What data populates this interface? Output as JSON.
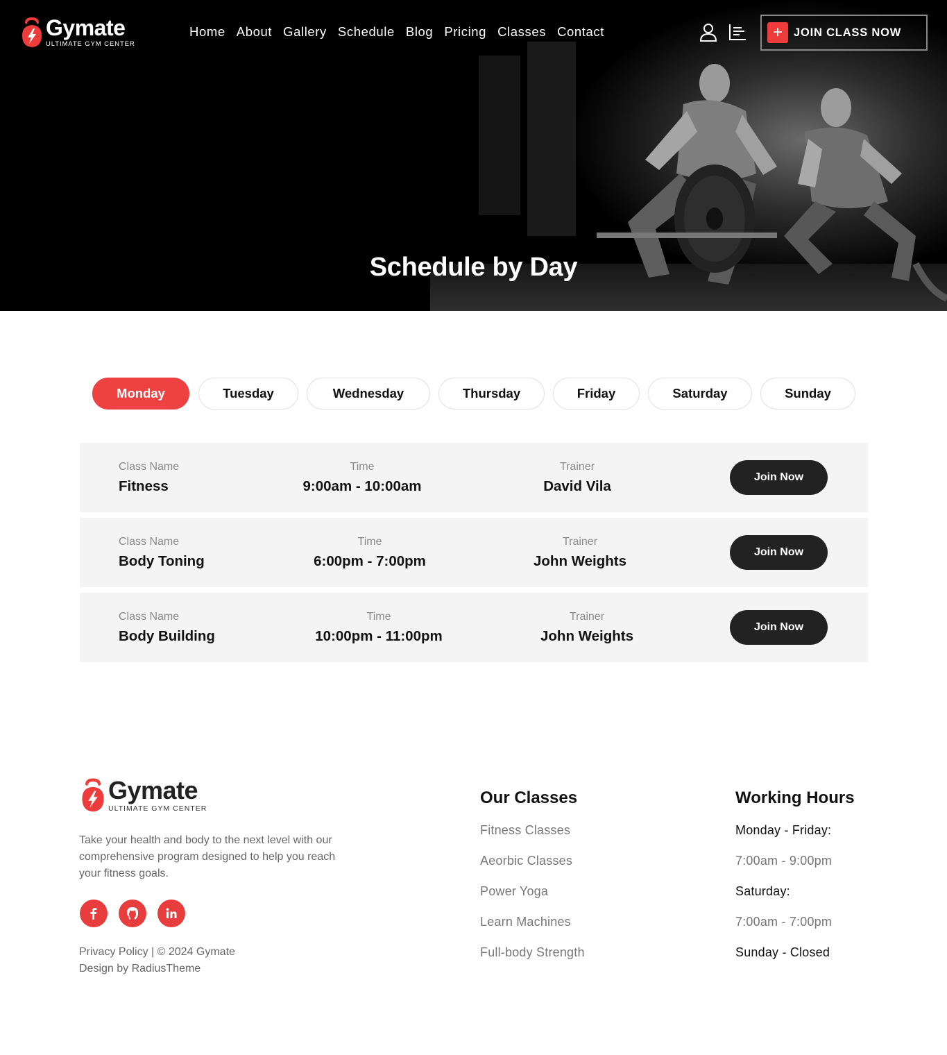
{
  "brand": {
    "name": "Gymate",
    "tagline": "ULTIMATE GYM CENTER"
  },
  "nav": {
    "items": [
      "Home",
      "About",
      "Gallery",
      "Schedule",
      "Blog",
      "Pricing",
      "Classes",
      "Contact"
    ]
  },
  "header": {
    "user_icon": "user-icon",
    "menu_icon": "align-left-icon",
    "cta_label": "JOIN CLASS NOW"
  },
  "hero": {
    "title": "Schedule by Day"
  },
  "days": {
    "items": [
      "Monday",
      "Tuesday",
      "Wednesday",
      "Thursday",
      "Friday",
      "Saturday",
      "Sunday"
    ],
    "active": "Monday"
  },
  "schedule": {
    "label_class": "Class Name",
    "label_time": "Time",
    "label_trainer": "Trainer",
    "button_label": "Join Now",
    "rows": [
      {
        "class_name": "Fitness",
        "time": "9:00am - 10:00am",
        "trainer": "David Vila"
      },
      {
        "class_name": "Body Toning",
        "time": "6:00pm - 7:00pm",
        "trainer": "John Weights"
      },
      {
        "class_name": "Body Building",
        "time": "10:00pm - 11:00pm",
        "trainer": "John Weights"
      }
    ]
  },
  "footer": {
    "description": "Take your health and body to the next level with our comprehensive program designed to help you reach your fitness goals.",
    "social": [
      "facebook-icon",
      "github-icon",
      "linkedin-icon"
    ],
    "copyright": "Privacy Policy | © 2024 Gymate",
    "credit": "Design by RadiusTheme",
    "classes_heading": "Our Classes",
    "classes": [
      "Fitness Classes",
      "Aeorbic Classes",
      "Power Yoga",
      "Learn Machines",
      "Full-body Strength"
    ],
    "hours_heading": "Working Hours",
    "hours": [
      "Monday - Friday:",
      "7:00am - 9:00pm",
      "Saturday:",
      "7:00am - 7:00pm",
      "Sunday - Closed"
    ]
  },
  "colors": {
    "accent": "#ee4141",
    "dark_button": "#222222",
    "row_bg": "#f4f4f4"
  }
}
